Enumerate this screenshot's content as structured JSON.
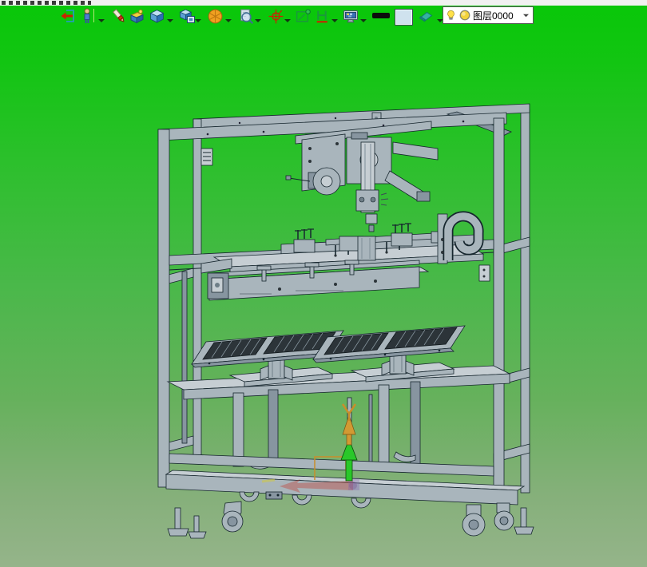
{
  "toolbar": {
    "icons": [
      {
        "name": "exit-door-icon"
      },
      {
        "name": "walk-figure-icon",
        "has_dropdown": true
      },
      {
        "name": "pencil-icon"
      },
      {
        "name": "material-box-icon"
      },
      {
        "name": "cube-icon",
        "has_dropdown": true
      },
      {
        "name": "cube-view-icon",
        "has_dropdown": true
      },
      {
        "name": "orange-sphere-icon",
        "has_dropdown": true
      },
      {
        "name": "zoom-document-icon",
        "has_dropdown": true
      },
      {
        "name": "crosshair-icon",
        "has_dropdown": true
      },
      {
        "name": "select-rect-icon"
      },
      {
        "name": "dimension-icon",
        "has_dropdown": true
      },
      {
        "name": "monitor-icon",
        "has_dropdown": true
      },
      {
        "name": "line-width-swatch"
      },
      {
        "name": "color-swatch",
        "color": "#cfe2ee"
      },
      {
        "name": "eraser-icon",
        "has_dropdown": true
      }
    ],
    "layer_combo": {
      "value": "图层0000",
      "icons": [
        "bulb-icon",
        "layer-circle-icon"
      ]
    }
  },
  "viewport": {
    "background": {
      "top": "#09c709",
      "middle": "#4ab84a",
      "bottom": "#95b48a"
    },
    "model": {
      "name": "machine-frame-assembly",
      "body_color": "#a9b5bc",
      "outline_color": "#16262e",
      "tray_slot_color": "#2c3439",
      "axis_marker": {
        "green": "#29c829",
        "orange": "#cf9130",
        "ghost_red": "#b45a4e"
      }
    }
  }
}
